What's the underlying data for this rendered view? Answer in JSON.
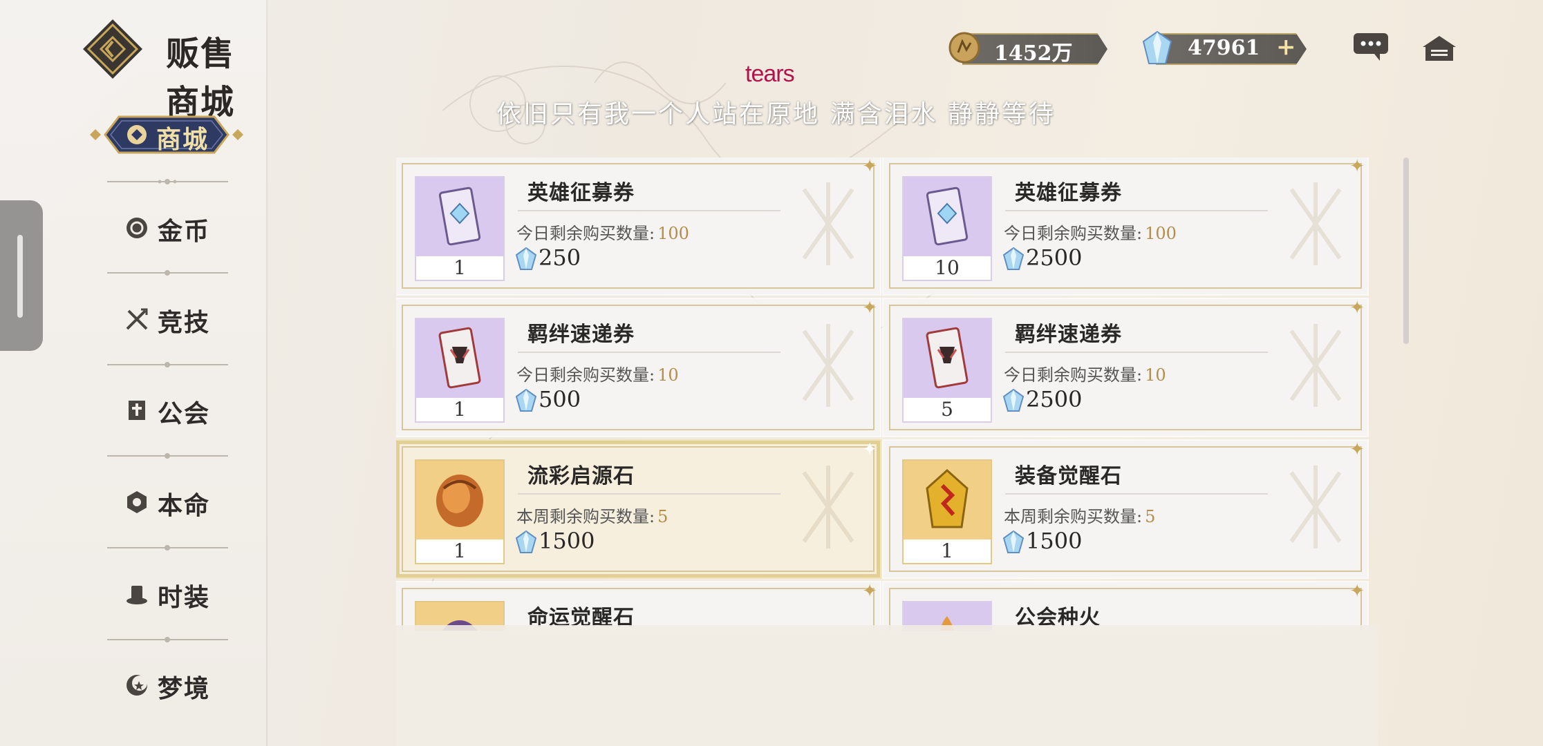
{
  "header": {
    "title": "贩售商城",
    "gold": "1452万",
    "gems": "47961",
    "plus": "+"
  },
  "lyrics": {
    "en": "tears",
    "cn": "依旧只有我一个人站在原地  满含泪水  静静等待"
  },
  "sidebar": {
    "active": "商城",
    "items": [
      {
        "label": "金币",
        "icon": "coin-icon"
      },
      {
        "label": "竞技",
        "icon": "crossed-swords-icon"
      },
      {
        "label": "公会",
        "icon": "guild-banner-icon"
      },
      {
        "label": "本命",
        "icon": "crest-icon"
      },
      {
        "label": "时装",
        "icon": "top-hat-icon"
      },
      {
        "label": "梦境",
        "icon": "crescent-star-icon"
      }
    ]
  },
  "shop": {
    "items": [
      {
        "name": "英雄征募券",
        "limit_label": "今日剩余购买数量:",
        "limit": "100",
        "qty": "1",
        "price": "250",
        "art": "purple-ticket"
      },
      {
        "name": "英雄征募券",
        "limit_label": "今日剩余购买数量:",
        "limit": "100",
        "qty": "10",
        "price": "2500",
        "art": "purple-ticket"
      },
      {
        "name": "羁绊速递券",
        "limit_label": "今日剩余购买数量:",
        "limit": "10",
        "qty": "1",
        "price": "500",
        "art": "red-ticket"
      },
      {
        "name": "羁绊速递券",
        "limit_label": "今日剩余购买数量:",
        "limit": "10",
        "qty": "5",
        "price": "2500",
        "art": "red-ticket"
      },
      {
        "name": "流彩启源石",
        "limit_label": "本周剩余购买数量:",
        "limit": "5",
        "qty": "1",
        "price": "1500",
        "art": "orange-stone",
        "selected": true
      },
      {
        "name": "装备觉醒石",
        "limit_label": "本周剩余购买数量:",
        "limit": "5",
        "qty": "1",
        "price": "1500",
        "art": "yellow-stone"
      },
      {
        "name": "命运觉醒石",
        "limit_label": "",
        "limit": "",
        "qty": "",
        "price": "",
        "art": "purple-stone"
      },
      {
        "name": "公会种火",
        "limit_label": "",
        "limit": "",
        "qty": "",
        "price": "",
        "art": "fire-token"
      }
    ]
  },
  "colors": {
    "accent": "#c8a65a",
    "active_tab": "#2f3a63",
    "price_text": "#b58c4a"
  }
}
